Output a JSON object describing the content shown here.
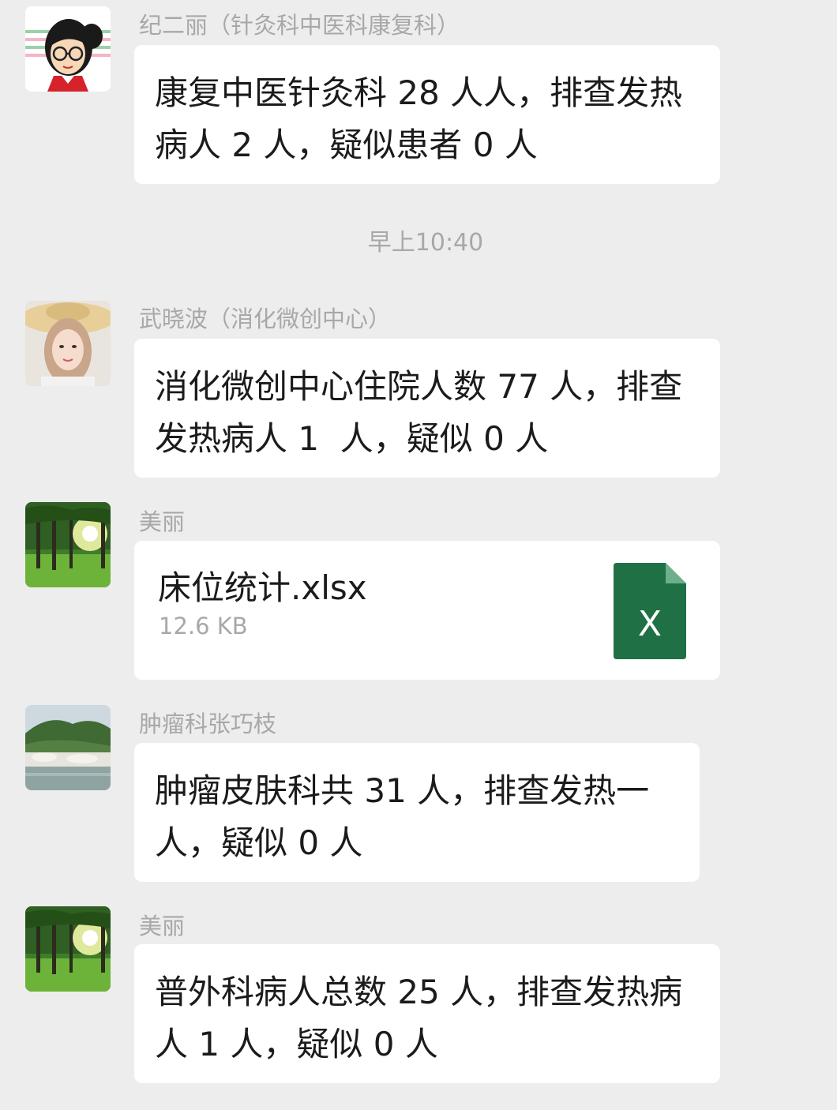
{
  "timestamp": "早上10:40",
  "messages": [
    {
      "sender": "纪二丽（针灸科中医科康复科）",
      "avatar": "cartoon-girl-avatar",
      "text": "康复中医针灸科 28 人人，排查发热\n病人 2 人，疑似患者 0 人"
    },
    {
      "sender": "武晓波（消化微创中心）",
      "avatar": "woman-straw-hat-avatar",
      "text": "消化微创中心住院人数 77 人，排查\n发热病人 1  人，疑似 0 人"
    },
    {
      "sender": "美丽",
      "avatar": "sunlit-forest-avatar",
      "file": {
        "name": "床位统计.xlsx",
        "size": "12.6 KB",
        "icon": "excel-file-icon",
        "icon_letter": "X",
        "icon_color": "#1f7145"
      }
    },
    {
      "sender": "肿瘤科张巧枝",
      "avatar": "lake-landscape-avatar",
      "text": "肿瘤皮肤科共 31 人，排查发热一\n人，疑似 0 人"
    },
    {
      "sender": "美丽",
      "avatar": "sunlit-forest-avatar",
      "text": "普外科病人总数 25 人，排查发热病\n人 1 人，疑似 0 人"
    }
  ]
}
